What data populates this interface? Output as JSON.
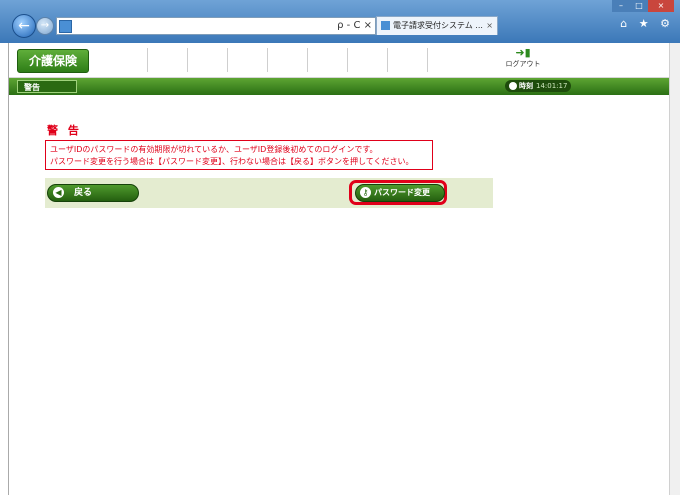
{
  "browser": {
    "tab_title": "電子請求受付システム ...",
    "addr_tools": "ρ - C ×",
    "tab_close": "×",
    "toolbar_icons": "⌂ ★ ⚙"
  },
  "header": {
    "logo": "介護保険",
    "logout_label": "ログアウト"
  },
  "statusbar": {
    "warn_label": "警告",
    "time_label": "時刻",
    "time_value": "14:01:17"
  },
  "content": {
    "title": "警 告",
    "message_line1": "ユーザIDのパスワードの有効期限が切れているか、ユーザID登録後初めてのログインです。",
    "message_line2": "パスワード変更を行う場合は【パスワード変更】、行わない場合は【戻る】ボタンを押してください。"
  },
  "buttons": {
    "back_label": "戻る",
    "password_label": "パスワード変更"
  },
  "colors": {
    "accent_green": "#2e7d17",
    "warning_red": "#e0001a"
  }
}
